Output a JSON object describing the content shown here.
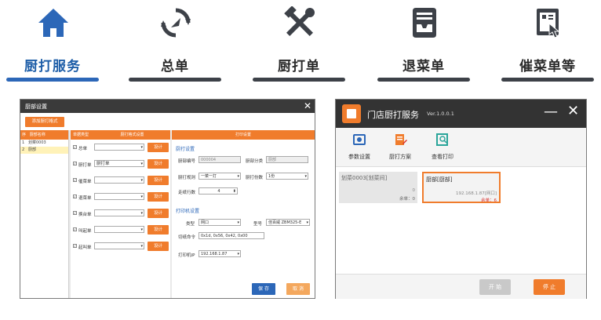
{
  "nav": [
    {
      "label": "厨打服务",
      "icon": "home-icon"
    },
    {
      "label": "总单",
      "icon": "refresh-icon"
    },
    {
      "label": "厨打单",
      "icon": "tools-icon"
    },
    {
      "label": "退菜单",
      "icon": "tray-icon"
    },
    {
      "label": "催菜单等",
      "icon": "touch-icon"
    }
  ],
  "colors": {
    "accent": "#f07c2c",
    "blue": "#2c67b8",
    "dark_bar": "#3d4148"
  },
  "dialog": {
    "title": "厨部设置",
    "add_button": "添加厨打格式",
    "list_headers": [
      "序",
      "厨部名称"
    ],
    "list_rows": [
      {
        "num": "1",
        "name": "划菜0003"
      },
      {
        "num": "2",
        "name": "厨部"
      }
    ],
    "type_headers": [
      "单据类型",
      "厨打格式设置"
    ],
    "type_rows": [
      {
        "name": "总单",
        "value": "",
        "checked": true
      },
      {
        "name": "厨打单",
        "value": "厨打单",
        "checked": true
      },
      {
        "name": "催菜单",
        "value": "",
        "checked": true
      },
      {
        "name": "退菜单",
        "value": "",
        "checked": true
      },
      {
        "name": "换台单",
        "value": "",
        "checked": true
      },
      {
        "name": "叫起单",
        "value": "",
        "checked": true
      },
      {
        "name": "起叫单",
        "value": "",
        "checked": true
      }
    ],
    "set_label": "设计",
    "print_header": "打印设置",
    "kitchen_section": "厨打设置",
    "kitchen_no_label": "厨部编号",
    "kitchen_no_value": "000004",
    "kitchen_class_label": "厨部分类",
    "kitchen_class_value": "厨部",
    "print_rule_label": "厨打规则",
    "print_rule_value": "一菜一打",
    "print_copies_label": "厨打份数",
    "print_copies_value": "1份",
    "feed_lines_label": "走纸行数",
    "feed_lines_value": "4",
    "printer_section": "打印机设置",
    "type_label": "类型",
    "type_value": "网口",
    "model_label": "型号",
    "model_value": "佳百威 ZBM325-E",
    "cut_label": "切纸命令",
    "cut_value": "0x1d, 0x56, 0x42, 0x00",
    "ip_label": "打印机IP",
    "ip_value": "192.168.1.87",
    "save_label": "保 存",
    "cancel_label": "取 消"
  },
  "window": {
    "title": "门店厨打服务",
    "version": "Ver.1.0.0.1",
    "toolbar": [
      {
        "label": "参数设置",
        "icon": "settings-icon"
      },
      {
        "label": "厨打方案",
        "icon": "edit-icon"
      },
      {
        "label": "查看打印",
        "icon": "search-icon"
      }
    ],
    "cards": [
      {
        "name": "划菜0003[划菜间]",
        "addr": "0",
        "count": "余单：0"
      },
      {
        "name": "厨部[厨部]",
        "addr": "192.168.1.87[网口]",
        "count": "余单：6"
      }
    ],
    "start_label": "开 始",
    "stop_label": "停 止"
  }
}
